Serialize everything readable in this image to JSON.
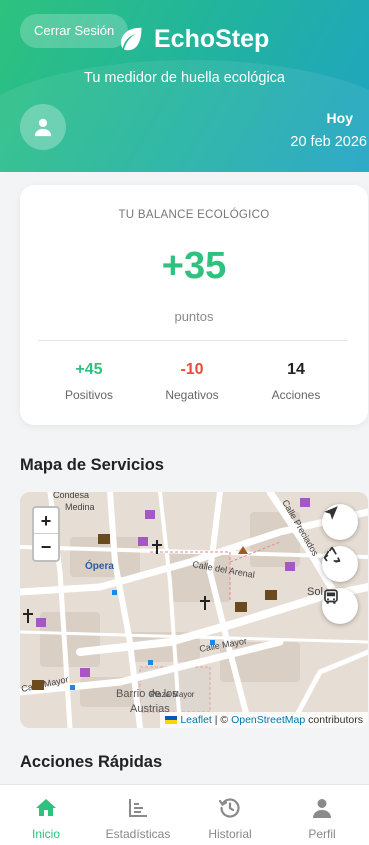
{
  "header": {
    "logout_label": "Cerrar Sesión",
    "app_name": "EchoStep",
    "tagline": "Tu medidor de huella ecológica",
    "day_label": "Hoy",
    "date": "20 feb 2026"
  },
  "balance": {
    "title": "TU BALANCE ECOLÓGICO",
    "score": "+35",
    "unit": "puntos",
    "positives": {
      "value": "+45",
      "label": "Positivos"
    },
    "negatives": {
      "value": "-10",
      "label": "Negativos"
    },
    "actions": {
      "value": "14",
      "label": "Acciones"
    }
  },
  "map": {
    "title": "Mapa de Servicios",
    "zoom_in": "+",
    "zoom_out": "−",
    "street_labels": {
      "opera": "Ópera",
      "arenal": "Calle del Arenal",
      "mayor": "Calle Mayor",
      "mayor_left": "Calle Mayor",
      "plaza_mayor": "Plaza Mayor",
      "barrio": "Barrio de los",
      "austrias": "Austrias",
      "precados": "Calle Preciados",
      "sol": "Sol",
      "condesa": "Condesa",
      "medina": "Medina"
    },
    "attribution": {
      "leaflet": "Leaflet",
      "separator": " | © ",
      "osm": "OpenStreetMap",
      "contributors": " contributors"
    }
  },
  "quick_actions": {
    "title": "Acciones Rápidas"
  },
  "nav": [
    {
      "label": "Inicio",
      "icon": "home-icon",
      "active": true
    },
    {
      "label": "Estadísticas",
      "icon": "chart-icon",
      "active": false
    },
    {
      "label": "Historial",
      "icon": "history-icon",
      "active": false
    },
    {
      "label": "Perfil",
      "icon": "profile-icon",
      "active": false
    }
  ],
  "colors": {
    "accent": "#2ec27e",
    "negative": "#e74c3c",
    "header_gradient_end": "#1fa3c4"
  }
}
